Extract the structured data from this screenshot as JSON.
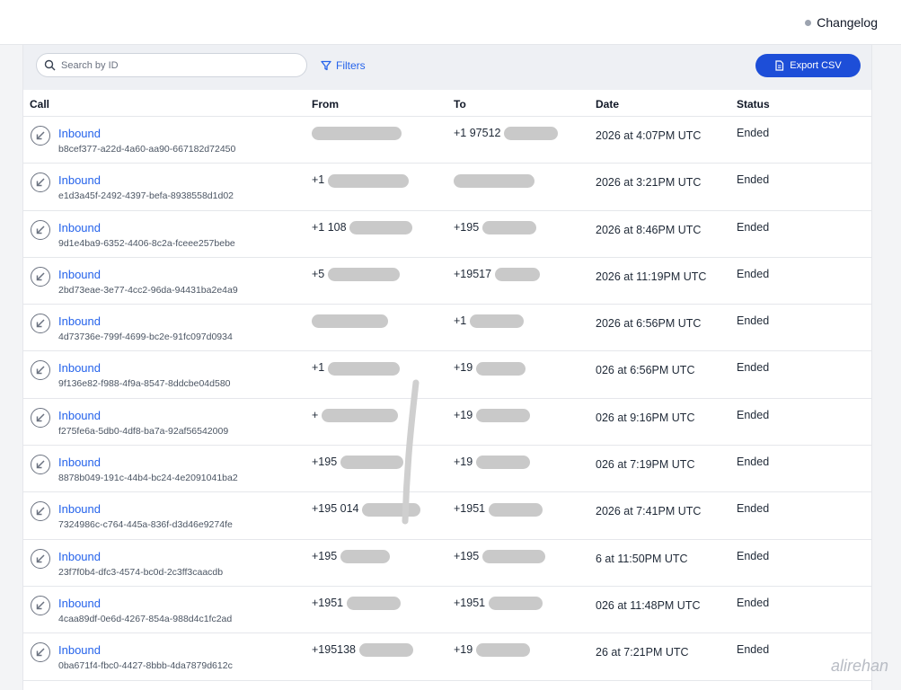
{
  "header": {
    "changelog_label": "Changelog"
  },
  "toolbar": {
    "search_placeholder": "Search by ID",
    "filters_label": "Filters",
    "export_label": "Export CSV"
  },
  "table": {
    "columns": [
      "Call",
      "From",
      "To",
      "Date",
      "Status"
    ],
    "rows": [
      {
        "type": "Inbound",
        "id": "b8cef377-a22d-4a60-aa90-667182d72450",
        "from": "",
        "to": "+1 97512",
        "date": "2026 at 4:07PM UTC",
        "status": "Ended"
      },
      {
        "type": "Inbound",
        "id": "e1d3a45f-2492-4397-befa-8938558d1d02",
        "from": "+1",
        "to": "",
        "date": "2026 at 3:21PM UTC",
        "status": "Ended"
      },
      {
        "type": "Inbound",
        "id": "9d1e4ba9-6352-4406-8c2a-fceee257bebe",
        "from": "+1 108",
        "to": "+195",
        "date": "2026 at 8:46PM UTC",
        "status": "Ended"
      },
      {
        "type": "Inbound",
        "id": "2bd73eae-3e77-4cc2-96da-94431ba2e4a9",
        "from": "+5",
        "to": "+19517",
        "date": "2026 at 11:19PM UTC",
        "status": "Ended"
      },
      {
        "type": "Inbound",
        "id": "4d73736e-799f-4699-bc2e-91fc097d0934",
        "from": "",
        "to": "+1",
        "date": "2026 at 6:56PM UTC",
        "status": "Ended"
      },
      {
        "type": "Inbound",
        "id": "9f136e82-f988-4f9a-8547-8ddcbe04d580",
        "from": "+1",
        "to": "+19",
        "date": "026 at 6:56PM UTC",
        "status": "Ended"
      },
      {
        "type": "Inbound",
        "id": "f275fe6a-5db0-4df8-ba7a-92af56542009",
        "from": "+",
        "to": "+19",
        "date": "026 at 9:16PM UTC",
        "status": "Ended"
      },
      {
        "type": "Inbound",
        "id": "8878b049-191c-44b4-bc24-4e2091041ba2",
        "from": "+195",
        "to": "+19",
        "date": "026 at 7:19PM UTC",
        "status": "Ended"
      },
      {
        "type": "Inbound",
        "id": "7324986c-c764-445a-836f-d3d46e9274fe",
        "from": "+195 014",
        "to": "+1951",
        "date": "2026 at 7:41PM UTC",
        "status": "Ended"
      },
      {
        "type": "Inbound",
        "id": "23f7f0b4-dfc3-4574-bc0d-2c3ff3caacdb",
        "from": "+195",
        "to": "+195",
        "date": "6 at 11:50PM UTC",
        "status": "Ended"
      },
      {
        "type": "Inbound",
        "id": "4caa89df-0e6d-4267-854a-988d4c1fc2ad",
        "from": "+1951",
        "to": "+1951",
        "date": "026 at 11:48PM UTC",
        "status": "Ended"
      },
      {
        "type": "Inbound",
        "id": "0ba671f4-fbc0-4427-8bbb-4da7879d612c",
        "from": "+195138",
        "to": "+19",
        "date": "26 at 7:21PM UTC",
        "status": "Ended"
      }
    ]
  },
  "watermark": "alirehan"
}
